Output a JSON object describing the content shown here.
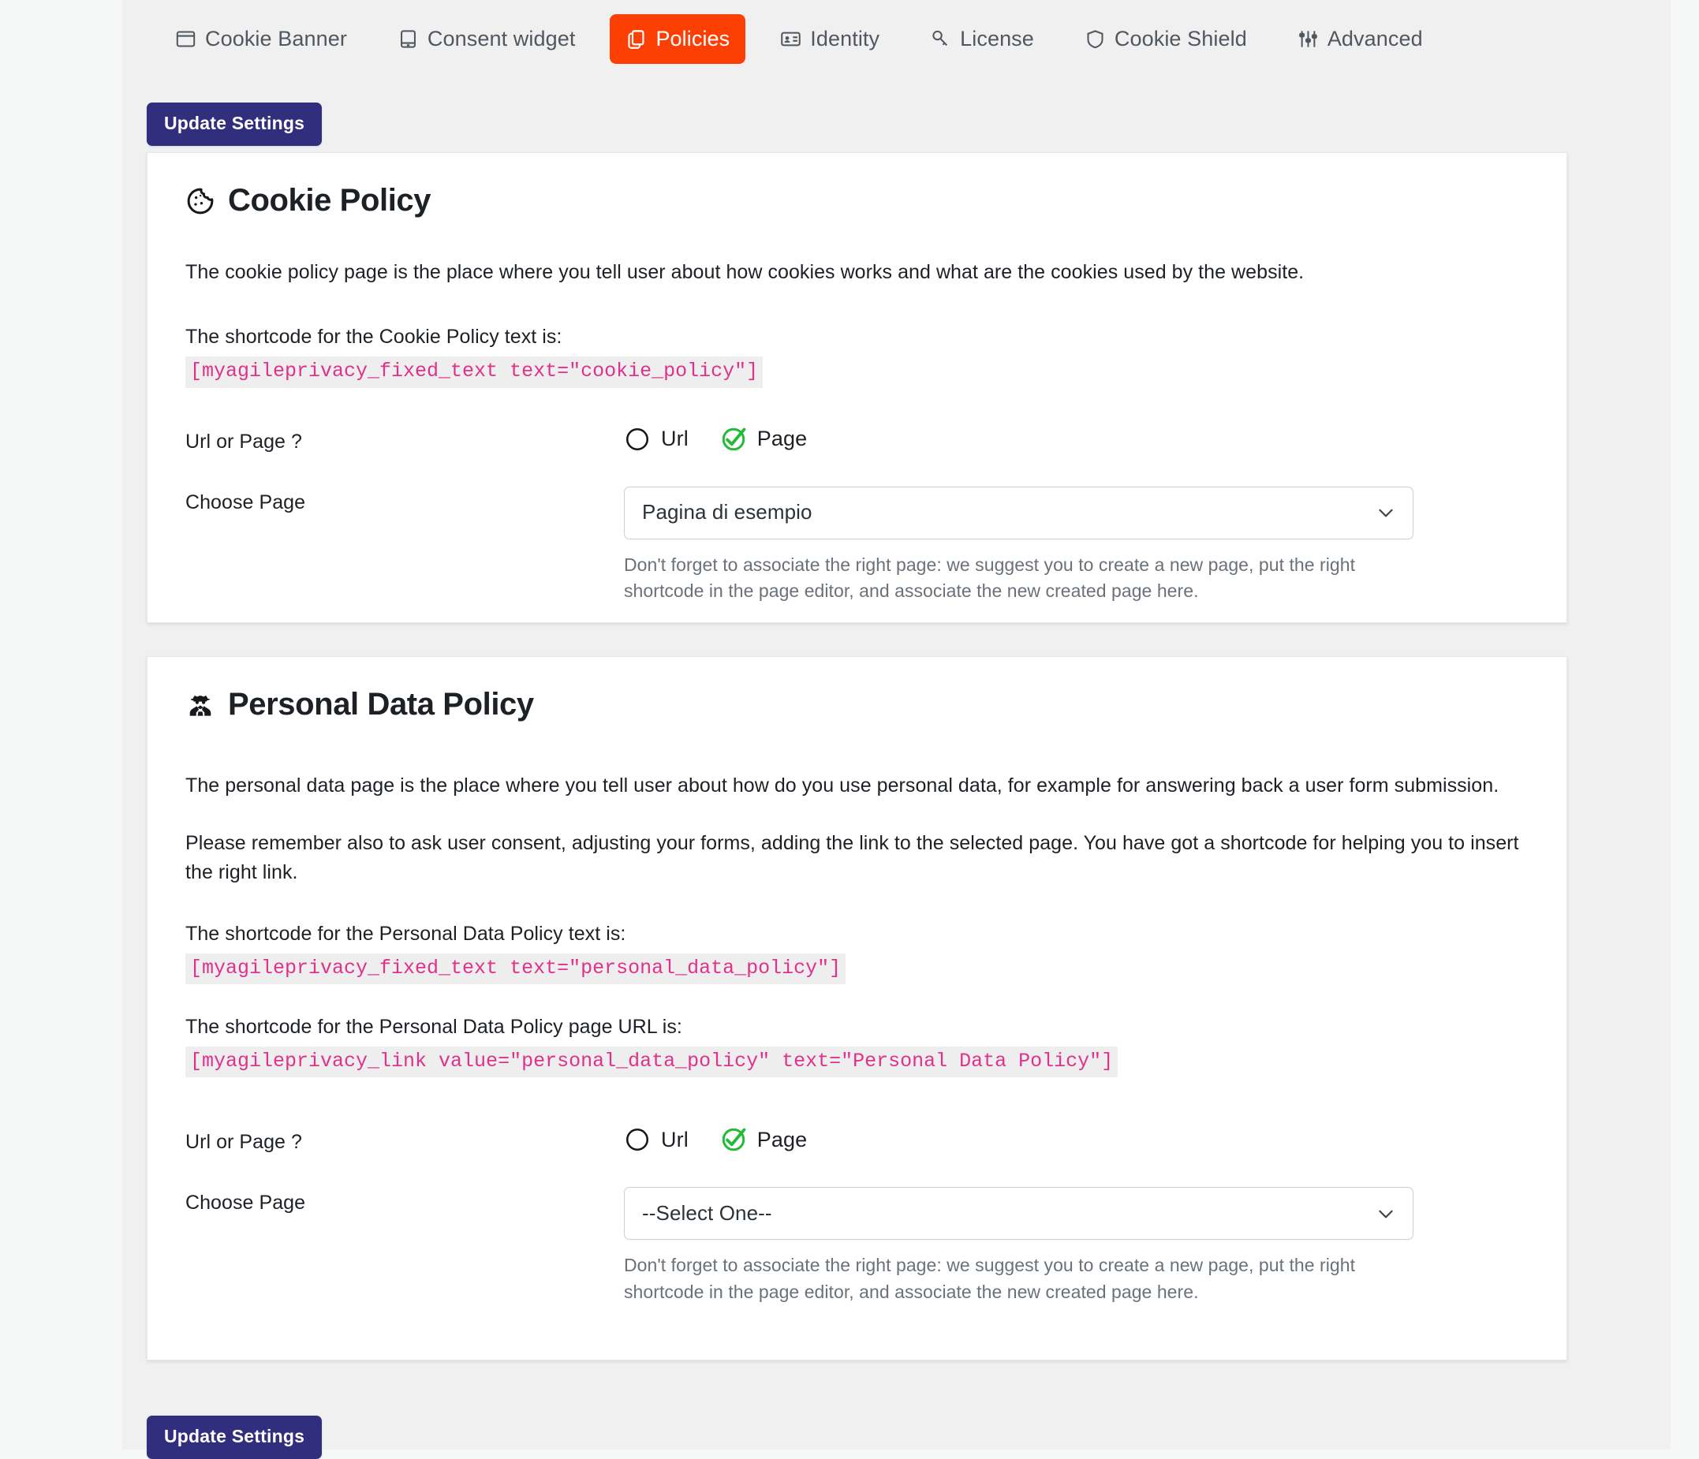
{
  "colors": {
    "active_tab_bg": "#fc4005",
    "button_bg": "#312e7e",
    "shortcode_text": "#e0318b",
    "shortcode_bg": "#eeeeee",
    "radio_checked": "#22bb33",
    "page_bg": "#f0f0f1"
  },
  "tabs": [
    {
      "label": "Cookie Banner",
      "icon": "window-icon",
      "active": false
    },
    {
      "label": "Consent widget",
      "icon": "mobile-icon",
      "active": false
    },
    {
      "label": "Policies",
      "icon": "copy-icon",
      "active": true
    },
    {
      "label": "Identity",
      "icon": "id-card-icon",
      "active": false
    },
    {
      "label": "License",
      "icon": "key-icon",
      "active": false
    },
    {
      "label": "Cookie Shield",
      "icon": "shield-icon",
      "active": false
    },
    {
      "label": "Advanced",
      "icon": "sliders-icon",
      "active": false
    }
  ],
  "toolbar": {
    "update_label_top": "Update Settings",
    "update_label_bottom": "Update Settings"
  },
  "cookie_policy": {
    "icon": "cookie-icon",
    "title": "Cookie Policy",
    "description": "The cookie policy page is the place where you tell user about how cookies works and what are the cookies used by the website.",
    "shortcode_label": "The shortcode for the Cookie Policy text is:",
    "shortcode": "[myagileprivacy_fixed_text text=\"cookie_policy\"]",
    "url_or_page_label": "Url or Page ?",
    "radio_url_label": "Url",
    "radio_page_label": "Page",
    "selected_radio": "Page",
    "choose_page_label": "Choose Page",
    "selected_page": "Pagina di esempio",
    "page_options": [
      "Pagina di esempio"
    ],
    "hint": "Don't forget to associate the right page: we suggest you to create a new page, put the right shortcode in the page editor, and associate the new created page here."
  },
  "personal_data_policy": {
    "icon": "detective-icon",
    "title": "Personal Data Policy",
    "description_1": "The personal data page is the place where you tell user about how do you use personal data, for example for answering back a user form submission.",
    "description_2": "Please remember also to ask user consent, adjusting your forms, adding the link to the selected page. You have got a shortcode for helping you to insert the right link.",
    "shortcode_text_label": "The shortcode for the Personal Data Policy text is:",
    "shortcode_text": "[myagileprivacy_fixed_text text=\"personal_data_policy\"]",
    "shortcode_url_label": "The shortcode for the Personal Data Policy page URL is:",
    "shortcode_url": "[myagileprivacy_link value=\"personal_data_policy\" text=\"Personal Data Policy\"]",
    "url_or_page_label": "Url or Page ?",
    "radio_url_label": "Url",
    "radio_page_label": "Page",
    "selected_radio": "Page",
    "choose_page_label": "Choose Page",
    "selected_page": "--Select One--",
    "page_options": [
      "--Select One--"
    ],
    "hint": "Don't forget to associate the right page: we suggest you to create a new page, put the right shortcode in the page editor, and associate the new created page here."
  }
}
